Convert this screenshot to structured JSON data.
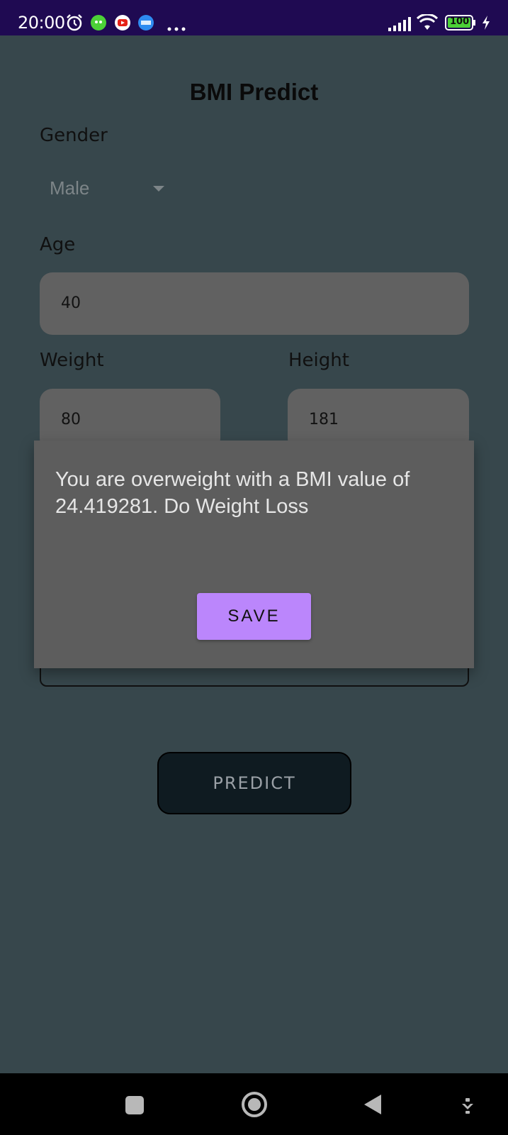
{
  "status_bar": {
    "time": "20:00",
    "battery": "100",
    "icons": [
      "alarm-icon",
      "app-notification-icon",
      "youtube-icon",
      "noveltoon-icon",
      "more-dots-icon",
      "signal-icon",
      "wifi-icon",
      "battery-icon",
      "charging-icon"
    ]
  },
  "app": {
    "title": "BMI Predict",
    "gender_label": "Gender",
    "gender_value": "Male",
    "age_label": "Age",
    "age_value": "40",
    "weight_label": "Weight",
    "weight_value": "80",
    "height_label": "Height",
    "height_value": "181",
    "predict_label": "PREDICT"
  },
  "dialog": {
    "message": "You are overweight with a BMI value of 24.419281. Do Weight Loss",
    "save_label": "SAVE"
  },
  "nav_bar": {
    "icons": [
      "recents-icon",
      "home-icon",
      "back-icon",
      "hide-navbar-icon"
    ]
  },
  "colors": {
    "background": "#37474c",
    "status_bar": "#1f0a52",
    "input": "#616161",
    "dialog": "#5d5d5d",
    "save_button": "#bb86fc",
    "predict_button": "#0f1b21"
  }
}
